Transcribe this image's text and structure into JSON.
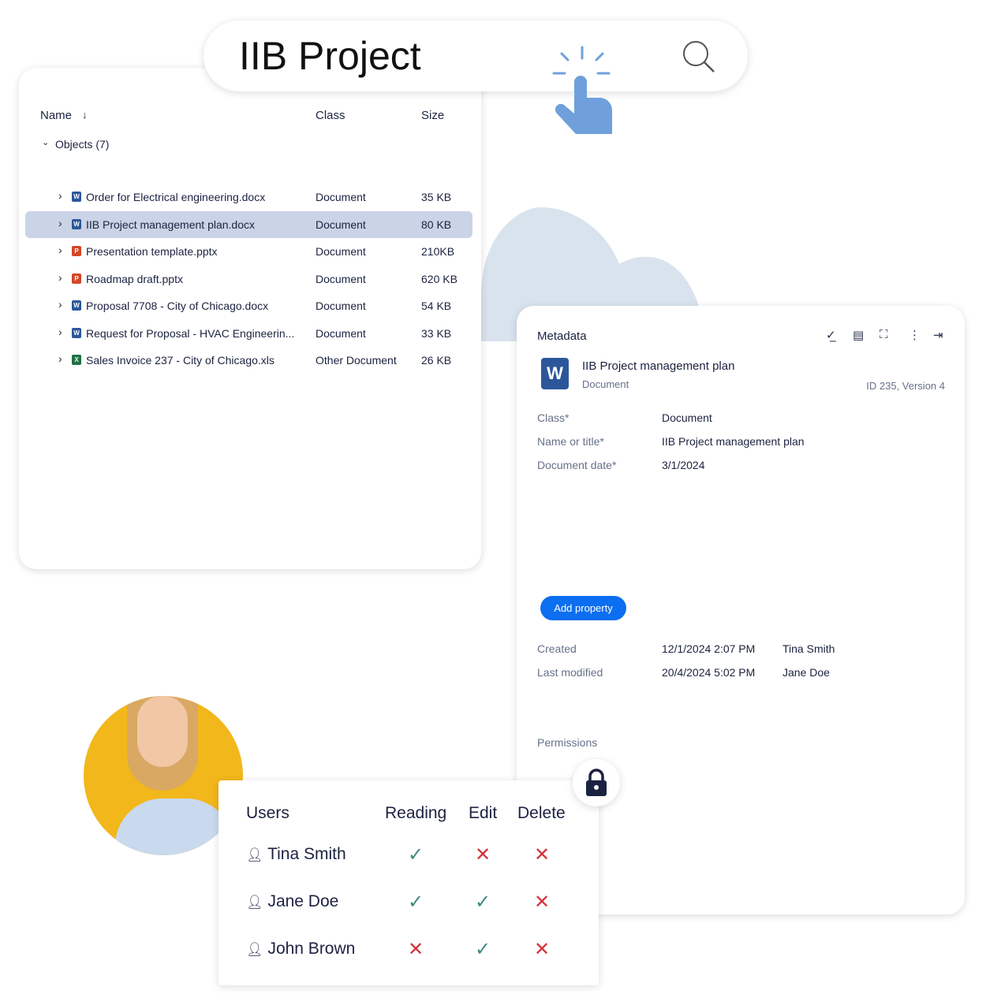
{
  "search": {
    "query": "IIB Project"
  },
  "files": {
    "columns": {
      "name": "Name",
      "class": "Class",
      "size": "Size"
    },
    "group": "Objects (7)",
    "rows": [
      {
        "name": "Order for Electrical engineering.docx",
        "class": "Document",
        "size": "35 KB",
        "type": "W",
        "color": "#2b579a"
      },
      {
        "name": "IIB Project management plan.docx",
        "class": "Document",
        "size": "80 KB",
        "type": "W",
        "color": "#2b579a",
        "selected": true
      },
      {
        "name": "Presentation template.pptx",
        "class": "Document",
        "size": "210KB",
        "type": "P",
        "color": "#d24726"
      },
      {
        "name": "Roadmap draft.pptx",
        "class": "Document",
        "size": "620 KB",
        "type": "P",
        "color": "#d24726"
      },
      {
        "name": "Proposal 7708 - City of Chicago.docx",
        "class": "Document",
        "size": "54 KB",
        "type": "W",
        "color": "#2b579a"
      },
      {
        "name": "Request for Proposal - HVAC Engineerin...",
        "class": "Document",
        "size": "33 KB",
        "type": "W",
        "color": "#2b579a"
      },
      {
        "name": "Sales Invoice 237 - City of Chicago.xls",
        "class": "Other Document",
        "size": "26 KB",
        "type": "X",
        "color": "#1e7145"
      }
    ]
  },
  "meta": {
    "title": "Metadata",
    "doc_title": "IIB Project management plan",
    "doc_class": "Document",
    "doc_icon": "W",
    "id_version": "ID 235, Version 4",
    "props": [
      {
        "label": "Class*",
        "value": "Document"
      },
      {
        "label": "Name or title*",
        "value": "IIB Project management plan"
      },
      {
        "label": "Document date*",
        "value": "3/1/2024"
      }
    ],
    "add_property": "Add property",
    "created": {
      "label": "Created",
      "date": "12/1/2024 2:07 PM",
      "user": "Tina Smith"
    },
    "modified": {
      "label": "Last modified",
      "date": "20/4/2024 5:02 PM",
      "user": "Jane Doe"
    },
    "permissions": "Permissions"
  },
  "perm": {
    "headers": {
      "users": "Users",
      "reading": "Reading",
      "edit": "Edit",
      "delete": "Delete"
    },
    "rows": [
      {
        "user": "Tina Smith",
        "reading": true,
        "edit": false,
        "delete": false
      },
      {
        "user": "Jane Doe",
        "reading": true,
        "edit": true,
        "delete": false
      },
      {
        "user": "John Brown",
        "reading": false,
        "edit": true,
        "delete": false
      }
    ]
  },
  "colors": {
    "accent": "#0c6ef0",
    "selected_row": "#cbd3e6",
    "check": "#3e8a83",
    "cross": "#d3323b",
    "avatar_bg": "#f2b71b",
    "cloud": "#d9e3ee",
    "pointer": "#6fa0dc"
  }
}
